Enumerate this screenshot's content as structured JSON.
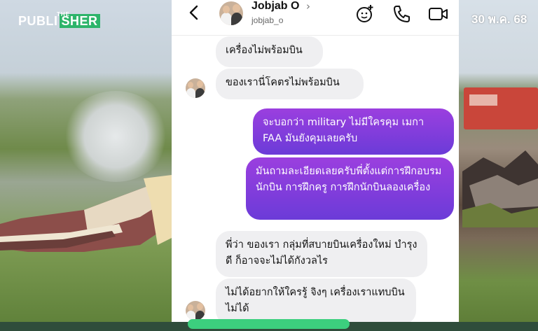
{
  "background": {
    "logo": {
      "the": "THE",
      "publ": "PUBLI",
      "sher": "SHER"
    },
    "date": "30 พ.ค. 68"
  },
  "header": {
    "name": "Jobjab O",
    "handle": "jobjab_o",
    "icons": [
      "back-arrow-icon",
      "effects-icon",
      "phone-icon",
      "video-camera-icon"
    ]
  },
  "messages": [
    {
      "side": "in",
      "text": "เครื่องไม่พร้อมบิน"
    },
    {
      "side": "in",
      "text": "ของเรานี่โคตรไม่พร้อมบิน"
    },
    {
      "side": "out",
      "text": "จะบอกว่า military ไม่มีใครคุม เมกา FAA มันยังคุมเลยครับ"
    },
    {
      "side": "out",
      "text": "มันถามละเอียดเลยครับพี่ตั้งแต่การฝึกอบรมนักบิน การฝึกครู การฝึกนักบินลองเครื่อง"
    },
    {
      "side": "in",
      "text": "พี่ว่า ของเรา กลุ่มที่สบายบินเครื่องใหม่ บำรุงดี ก็อาจจะไม่ได้กังวลไร"
    },
    {
      "side": "in",
      "text": "ไม่ได้อยากให้ใครรู้ จิงๆ เครื่องเราแทบบินไม่ได้"
    }
  ],
  "colors": {
    "outgoing_bubble": "#7c36d6",
    "incoming_bubble": "#efeff1",
    "brand_green": "#2db46a"
  }
}
